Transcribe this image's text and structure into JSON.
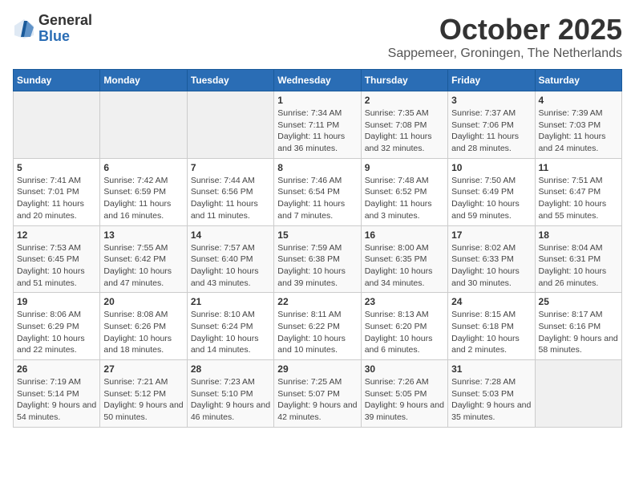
{
  "logo": {
    "general": "General",
    "blue": "Blue"
  },
  "header": {
    "title": "October 2025",
    "subtitle": "Sappemeer, Groningen, The Netherlands"
  },
  "weekdays": [
    "Sunday",
    "Monday",
    "Tuesday",
    "Wednesday",
    "Thursday",
    "Friday",
    "Saturday"
  ],
  "weeks": [
    [
      {
        "day": "",
        "detail": ""
      },
      {
        "day": "",
        "detail": ""
      },
      {
        "day": "",
        "detail": ""
      },
      {
        "day": "1",
        "detail": "Sunrise: 7:34 AM\nSunset: 7:11 PM\nDaylight: 11 hours\nand 36 minutes."
      },
      {
        "day": "2",
        "detail": "Sunrise: 7:35 AM\nSunset: 7:08 PM\nDaylight: 11 hours\nand 32 minutes."
      },
      {
        "day": "3",
        "detail": "Sunrise: 7:37 AM\nSunset: 7:06 PM\nDaylight: 11 hours\nand 28 minutes."
      },
      {
        "day": "4",
        "detail": "Sunrise: 7:39 AM\nSunset: 7:03 PM\nDaylight: 11 hours\nand 24 minutes."
      }
    ],
    [
      {
        "day": "5",
        "detail": "Sunrise: 7:41 AM\nSunset: 7:01 PM\nDaylight: 11 hours\nand 20 minutes."
      },
      {
        "day": "6",
        "detail": "Sunrise: 7:42 AM\nSunset: 6:59 PM\nDaylight: 11 hours\nand 16 minutes."
      },
      {
        "day": "7",
        "detail": "Sunrise: 7:44 AM\nSunset: 6:56 PM\nDaylight: 11 hours\nand 11 minutes."
      },
      {
        "day": "8",
        "detail": "Sunrise: 7:46 AM\nSunset: 6:54 PM\nDaylight: 11 hours\nand 7 minutes."
      },
      {
        "day": "9",
        "detail": "Sunrise: 7:48 AM\nSunset: 6:52 PM\nDaylight: 11 hours\nand 3 minutes."
      },
      {
        "day": "10",
        "detail": "Sunrise: 7:50 AM\nSunset: 6:49 PM\nDaylight: 10 hours\nand 59 minutes."
      },
      {
        "day": "11",
        "detail": "Sunrise: 7:51 AM\nSunset: 6:47 PM\nDaylight: 10 hours\nand 55 minutes."
      }
    ],
    [
      {
        "day": "12",
        "detail": "Sunrise: 7:53 AM\nSunset: 6:45 PM\nDaylight: 10 hours\nand 51 minutes."
      },
      {
        "day": "13",
        "detail": "Sunrise: 7:55 AM\nSunset: 6:42 PM\nDaylight: 10 hours\nand 47 minutes."
      },
      {
        "day": "14",
        "detail": "Sunrise: 7:57 AM\nSunset: 6:40 PM\nDaylight: 10 hours\nand 43 minutes."
      },
      {
        "day": "15",
        "detail": "Sunrise: 7:59 AM\nSunset: 6:38 PM\nDaylight: 10 hours\nand 39 minutes."
      },
      {
        "day": "16",
        "detail": "Sunrise: 8:00 AM\nSunset: 6:35 PM\nDaylight: 10 hours\nand 34 minutes."
      },
      {
        "day": "17",
        "detail": "Sunrise: 8:02 AM\nSunset: 6:33 PM\nDaylight: 10 hours\nand 30 minutes."
      },
      {
        "day": "18",
        "detail": "Sunrise: 8:04 AM\nSunset: 6:31 PM\nDaylight: 10 hours\nand 26 minutes."
      }
    ],
    [
      {
        "day": "19",
        "detail": "Sunrise: 8:06 AM\nSunset: 6:29 PM\nDaylight: 10 hours\nand 22 minutes."
      },
      {
        "day": "20",
        "detail": "Sunrise: 8:08 AM\nSunset: 6:26 PM\nDaylight: 10 hours\nand 18 minutes."
      },
      {
        "day": "21",
        "detail": "Sunrise: 8:10 AM\nSunset: 6:24 PM\nDaylight: 10 hours\nand 14 minutes."
      },
      {
        "day": "22",
        "detail": "Sunrise: 8:11 AM\nSunset: 6:22 PM\nDaylight: 10 hours\nand 10 minutes."
      },
      {
        "day": "23",
        "detail": "Sunrise: 8:13 AM\nSunset: 6:20 PM\nDaylight: 10 hours\nand 6 minutes."
      },
      {
        "day": "24",
        "detail": "Sunrise: 8:15 AM\nSunset: 6:18 PM\nDaylight: 10 hours\nand 2 minutes."
      },
      {
        "day": "25",
        "detail": "Sunrise: 8:17 AM\nSunset: 6:16 PM\nDaylight: 9 hours\nand 58 minutes."
      }
    ],
    [
      {
        "day": "26",
        "detail": "Sunrise: 7:19 AM\nSunset: 5:14 PM\nDaylight: 9 hours\nand 54 minutes."
      },
      {
        "day": "27",
        "detail": "Sunrise: 7:21 AM\nSunset: 5:12 PM\nDaylight: 9 hours\nand 50 minutes."
      },
      {
        "day": "28",
        "detail": "Sunrise: 7:23 AM\nSunset: 5:10 PM\nDaylight: 9 hours\nand 46 minutes."
      },
      {
        "day": "29",
        "detail": "Sunrise: 7:25 AM\nSunset: 5:07 PM\nDaylight: 9 hours\nand 42 minutes."
      },
      {
        "day": "30",
        "detail": "Sunrise: 7:26 AM\nSunset: 5:05 PM\nDaylight: 9 hours\nand 39 minutes."
      },
      {
        "day": "31",
        "detail": "Sunrise: 7:28 AM\nSunset: 5:03 PM\nDaylight: 9 hours\nand 35 minutes."
      },
      {
        "day": "",
        "detail": ""
      }
    ]
  ]
}
